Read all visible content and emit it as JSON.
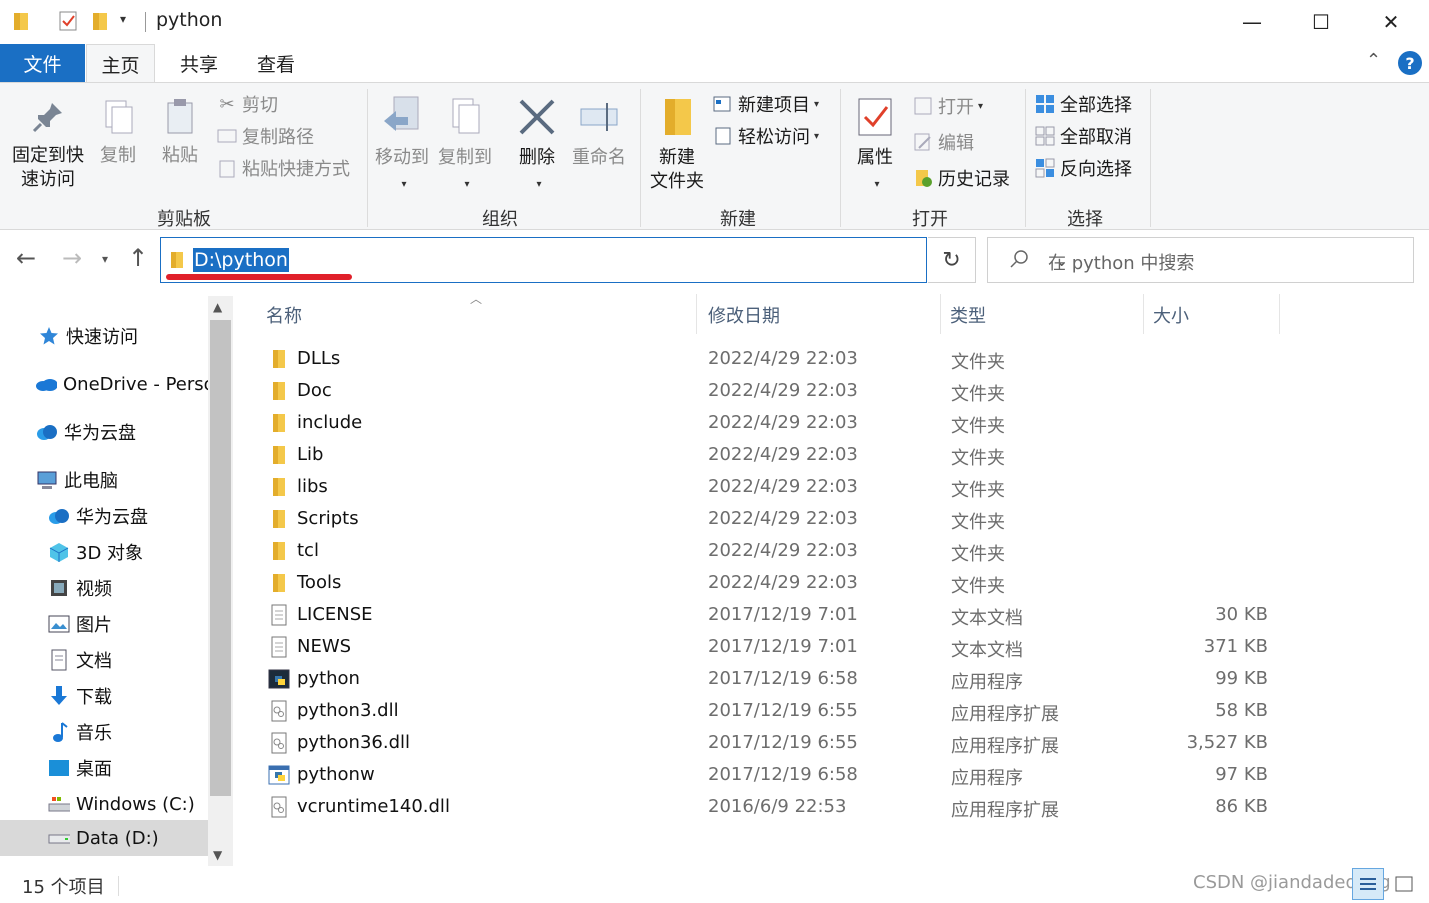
{
  "window": {
    "title": "python",
    "minimize": "—",
    "maximize": "☐",
    "close": "✕"
  },
  "ribbon_tabs": [
    {
      "label": "文件"
    },
    {
      "label": "主页"
    },
    {
      "label": "共享"
    },
    {
      "label": "查看"
    }
  ],
  "clipboard": {
    "pin_label_1": "固定到快",
    "pin_label_2": "速访问",
    "copy": "复制",
    "paste": "粘贴",
    "cut": "剪切",
    "copy_path": "复制路径",
    "paste_shortcut": "粘贴快捷方式",
    "group": "剪贴板"
  },
  "organize": {
    "move_to": "移动到",
    "copy_to": "复制到",
    "delete": "删除",
    "rename": "重命名",
    "group": "组织"
  },
  "new": {
    "new_folder_1": "新建",
    "new_folder_2": "文件夹",
    "new_item": "新建项目",
    "easy_access": "轻松访问",
    "group": "新建"
  },
  "open": {
    "properties": "属性",
    "open": "打开",
    "edit": "编辑",
    "history": "历史记录",
    "group": "打开"
  },
  "select": {
    "select_all": "全部选择",
    "select_none": "全部取消",
    "invert": "反向选择",
    "group": "选择"
  },
  "address": {
    "path": "D:\\python",
    "search_placeholder": "在 python 中搜索"
  },
  "nav_pane": [
    {
      "label": "快速访问",
      "icon": "star-icon"
    },
    {
      "label": "OneDrive - Personal",
      "icon": "onedrive-icon"
    },
    {
      "label": "华为云盘",
      "icon": "huawei-cloud-icon"
    },
    {
      "label": "此电脑",
      "icon": "computer-icon"
    },
    {
      "label": "华为云盘",
      "icon": "huawei-cloud-icon"
    },
    {
      "label": "3D 对象",
      "icon": "3d-objects-icon"
    },
    {
      "label": "视频",
      "icon": "video-icon"
    },
    {
      "label": "图片",
      "icon": "pictures-icon"
    },
    {
      "label": "文档",
      "icon": "documents-icon"
    },
    {
      "label": "下载",
      "icon": "download-icon"
    },
    {
      "label": "音乐",
      "icon": "music-icon"
    },
    {
      "label": "桌面",
      "icon": "desktop-icon"
    },
    {
      "label": "Windows (C:)",
      "icon": "drive-c-icon"
    },
    {
      "label": "Data (D:)",
      "icon": "drive-d-icon"
    }
  ],
  "columns": {
    "name": "名称",
    "modified": "修改日期",
    "type": "类型",
    "size": "大小"
  },
  "files": [
    {
      "name": "DLLs",
      "modified": "2022/4/29 22:03",
      "type": "文件夹",
      "size": "",
      "icon": "folder-icon"
    },
    {
      "name": "Doc",
      "modified": "2022/4/29 22:03",
      "type": "文件夹",
      "size": "",
      "icon": "folder-icon"
    },
    {
      "name": "include",
      "modified": "2022/4/29 22:03",
      "type": "文件夹",
      "size": "",
      "icon": "folder-icon"
    },
    {
      "name": "Lib",
      "modified": "2022/4/29 22:03",
      "type": "文件夹",
      "size": "",
      "icon": "folder-icon"
    },
    {
      "name": "libs",
      "modified": "2022/4/29 22:03",
      "type": "文件夹",
      "size": "",
      "icon": "folder-icon"
    },
    {
      "name": "Scripts",
      "modified": "2022/4/29 22:03",
      "type": "文件夹",
      "size": "",
      "icon": "folder-icon"
    },
    {
      "name": "tcl",
      "modified": "2022/4/29 22:03",
      "type": "文件夹",
      "size": "",
      "icon": "folder-icon"
    },
    {
      "name": "Tools",
      "modified": "2022/4/29 22:03",
      "type": "文件夹",
      "size": "",
      "icon": "folder-icon"
    },
    {
      "name": "LICENSE",
      "modified": "2017/12/19 7:01",
      "type": "文本文档",
      "size": "30 KB",
      "icon": "text-file-icon"
    },
    {
      "name": "NEWS",
      "modified": "2017/12/19 7:01",
      "type": "文本文档",
      "size": "371 KB",
      "icon": "text-file-icon"
    },
    {
      "name": "python",
      "modified": "2017/12/19 6:58",
      "type": "应用程序",
      "size": "99 KB",
      "icon": "python-exe-icon"
    },
    {
      "name": "python3.dll",
      "modified": "2017/12/19 6:55",
      "type": "应用程序扩展",
      "size": "58 KB",
      "icon": "dll-icon"
    },
    {
      "name": "python36.dll",
      "modified": "2017/12/19 6:55",
      "type": "应用程序扩展",
      "size": "3,527 KB",
      "icon": "dll-icon"
    },
    {
      "name": "pythonw",
      "modified": "2017/12/19 6:58",
      "type": "应用程序",
      "size": "97 KB",
      "icon": "pythonw-exe-icon"
    },
    {
      "name": "vcruntime140.dll",
      "modified": "2016/6/9 22:53",
      "type": "应用程序扩展",
      "size": "86 KB",
      "icon": "dll-icon"
    }
  ],
  "status": {
    "count": "15 个项目",
    "watermark": "CSDN @jiandadedong"
  },
  "colors": {
    "accent": "#1a6fc4",
    "folder": "#f4c84a",
    "annotation": "#e0202a"
  }
}
